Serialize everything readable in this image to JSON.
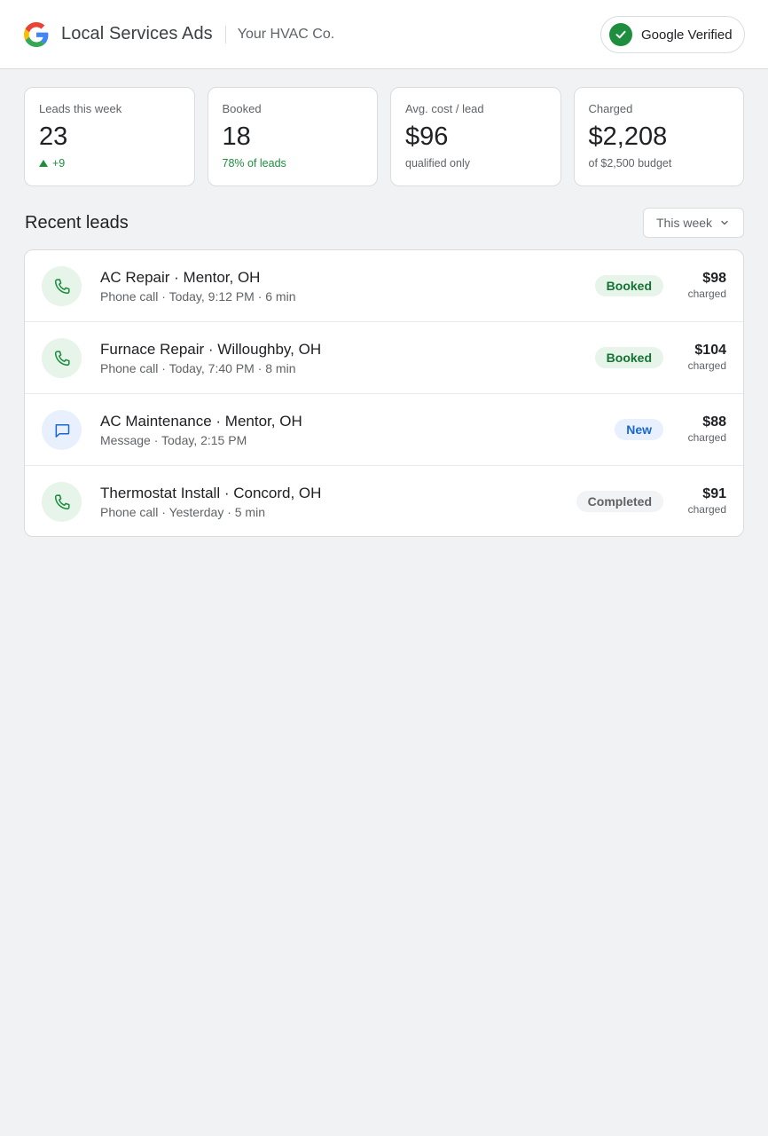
{
  "header": {
    "app_title": "Local Services Ads",
    "company": "Your HVAC Co.",
    "verified_label": "Google Verified",
    "logo_icon": "google-g-icon",
    "verified_icon": "check-circle-icon"
  },
  "stats": [
    {
      "label": "Leads this week",
      "value": "23",
      "sub": "+9",
      "sub_style": "green",
      "sub_icon": "trend-up-icon"
    },
    {
      "label": "Booked",
      "value": "18",
      "sub": "78% of leads",
      "sub_style": "green"
    },
    {
      "label": "Avg. cost / lead",
      "value": "$96",
      "sub": "qualified only",
      "sub_style": "muted"
    },
    {
      "label": "Charged",
      "value": "$2,208",
      "sub": "of $2,500 budget",
      "sub_style": "muted"
    }
  ],
  "recent": {
    "title": "Recent leads",
    "filter_label": "This week"
  },
  "leads": [
    {
      "type": "phone",
      "service": "AC Repair",
      "location": "Mentor, OH",
      "meta": "Phone call · Today, 9:12 PM · 6 min",
      "status": "Booked",
      "amount": "$98",
      "amount_sub": "charged"
    },
    {
      "type": "phone",
      "service": "Furnace Repair",
      "location": "Willoughby, OH",
      "meta": "Phone call · Today, 7:40 PM · 8 min",
      "status": "Booked",
      "amount": "$104",
      "amount_sub": "charged"
    },
    {
      "type": "message",
      "service": "AC Maintenance",
      "location": "Mentor, OH",
      "meta": "Message · Today, 2:15 PM",
      "status": "New",
      "amount": "$88",
      "amount_sub": "charged"
    },
    {
      "type": "phone",
      "service": "Thermostat Install",
      "location": "Concord, OH",
      "meta": "Phone call · Yesterday · 5 min",
      "status": "Completed",
      "amount": "$91",
      "amount_sub": "charged"
    }
  ],
  "colors": {
    "green": "#1e8e3e",
    "booked_text": "#137333",
    "new_text": "#1967d2",
    "background": "#f1f2f4"
  }
}
